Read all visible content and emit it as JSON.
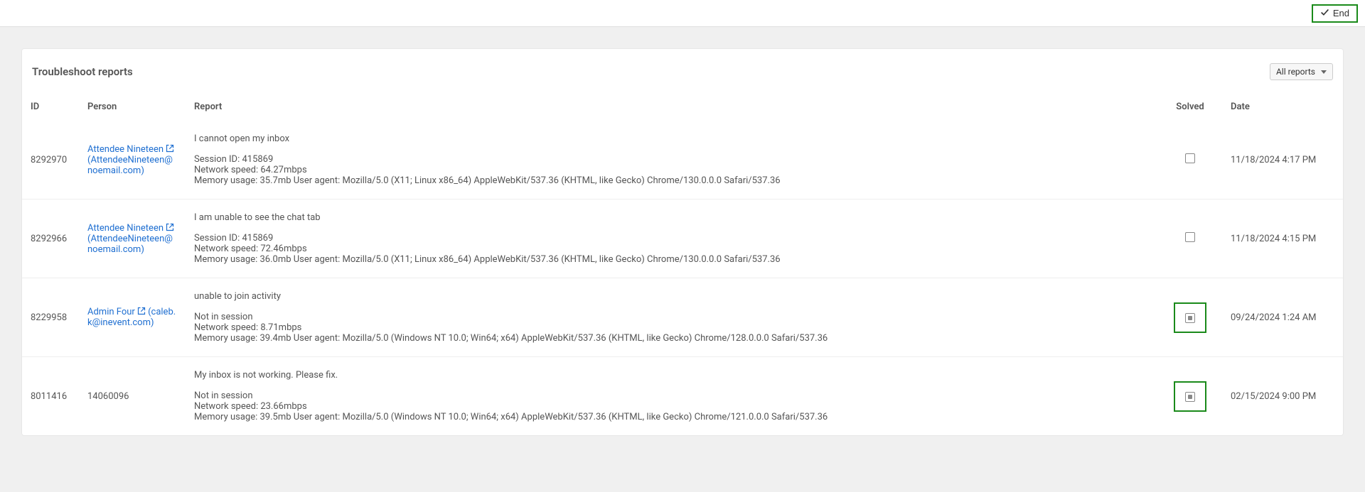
{
  "topbar": {
    "end_label": "End"
  },
  "card": {
    "title": "Troubleshoot reports",
    "filter_label": "All reports"
  },
  "columns": {
    "id": "ID",
    "person": "Person",
    "report": "Report",
    "solved": "Solved",
    "date": "Date"
  },
  "rows": [
    {
      "id": "8292970",
      "person_name": "Attendee Nineteen",
      "person_email": "(AttendeeNineteen@noemail.com)",
      "is_link": true,
      "issue": "I cannot open my inbox",
      "session": "Session ID: 415869",
      "network": "Network speed: 64.27mbps",
      "memory": "Memory usage: 35.7mb User agent: Mozilla/5.0 (X11; Linux x86_64) AppleWebKit/537.36 (KHTML, like Gecko) Chrome/130.0.0.0 Safari/537.36",
      "solved": false,
      "highlight_solved": false,
      "date": "11/18/2024 4:17 PM"
    },
    {
      "id": "8292966",
      "person_name": "Attendee Nineteen",
      "person_email": "(AttendeeNineteen@noemail.com)",
      "is_link": true,
      "issue": "I am unable to see the chat tab",
      "session": "Session ID: 415869",
      "network": "Network speed: 72.46mbps",
      "memory": "Memory usage: 36.0mb User agent: Mozilla/5.0 (X11; Linux x86_64) AppleWebKit/537.36 (KHTML, like Gecko) Chrome/130.0.0.0 Safari/537.36",
      "solved": false,
      "highlight_solved": false,
      "date": "11/18/2024 4:15 PM"
    },
    {
      "id": "8229958",
      "person_name": "Admin Four",
      "person_email": "(caleb.k@inevent.com)",
      "is_link": true,
      "issue": "unable to join activity",
      "session": "Not in session",
      "network": "Network speed: 8.71mbps",
      "memory": "Memory usage: 39.4mb User agent: Mozilla/5.0 (Windows NT 10.0; Win64; x64) AppleWebKit/537.36 (KHTML, like Gecko) Chrome/128.0.0.0 Safari/537.36",
      "solved": true,
      "highlight_solved": true,
      "date": "09/24/2024 1:24 AM"
    },
    {
      "id": "8011416",
      "person_name": "14060096",
      "person_email": "",
      "is_link": false,
      "issue": "My inbox is not working. Please fix.",
      "session": "Not in session",
      "network": "Network speed: 23.66mbps",
      "memory": "Memory usage: 39.5mb User agent: Mozilla/5.0 (Windows NT 10.0; Win64; x64) AppleWebKit/537.36 (KHTML, like Gecko) Chrome/121.0.0.0 Safari/537.36",
      "solved": true,
      "highlight_solved": true,
      "date": "02/15/2024 9:00 PM"
    }
  ]
}
